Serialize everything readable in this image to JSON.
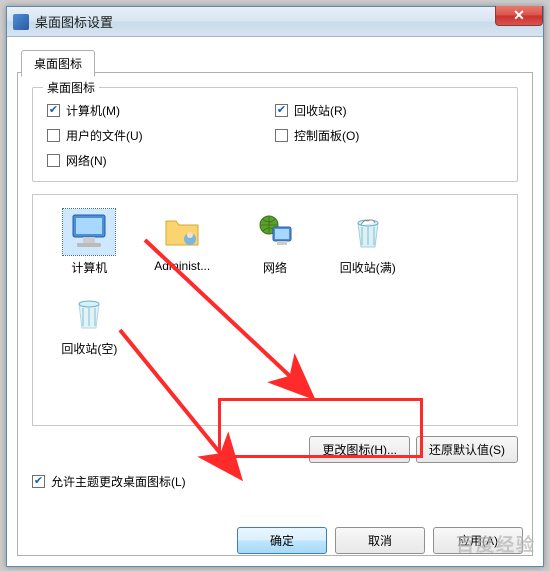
{
  "window": {
    "title": "桌面图标设置"
  },
  "tab": {
    "label": "桌面图标"
  },
  "group": {
    "title": "桌面图标",
    "items": {
      "computer": {
        "label": "计算机(M)",
        "checked": true
      },
      "recycle": {
        "label": "回收站(R)",
        "checked": true
      },
      "userfiles": {
        "label": "用户的文件(U)",
        "checked": false
      },
      "controlpanel": {
        "label": "控制面板(O)",
        "checked": false
      },
      "network": {
        "label": "网络(N)",
        "checked": false
      }
    }
  },
  "icons": {
    "computer": "计算机",
    "userfolder": "Administ...",
    "network": "网络",
    "recycle_full": "回收站(满)",
    "recycle_empty": "回收站(空)"
  },
  "buttons": {
    "change_icon": "更改图标(H)...",
    "restore_default": "还原默认值(S)",
    "ok": "确定",
    "cancel": "取消",
    "apply": "应用(A)"
  },
  "theme_check": {
    "label": "允许主题更改桌面图标(L)",
    "checked": true
  },
  "watermark": "百度经验"
}
